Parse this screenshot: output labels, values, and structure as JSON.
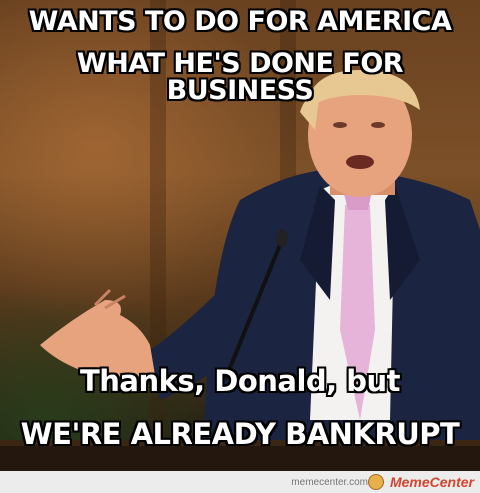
{
  "caption": {
    "top_line_1": "WANTS TO DO FOR AMERICA",
    "top_line_2": "WHAT HE'S DONE FOR BUSINESS",
    "bottom_line_1": "Thanks, Donald, but",
    "bottom_line_2": "WE'RE ALREADY BANKRUPT"
  },
  "watermark": {
    "site": "memecenter.com",
    "brand": "MemeCenter"
  },
  "colors": {
    "suit": "#1b2440",
    "tie": "#e6b4d8",
    "shirt": "#f4f2f0",
    "skin": "#e6a37e",
    "hair": "#e7c892"
  }
}
